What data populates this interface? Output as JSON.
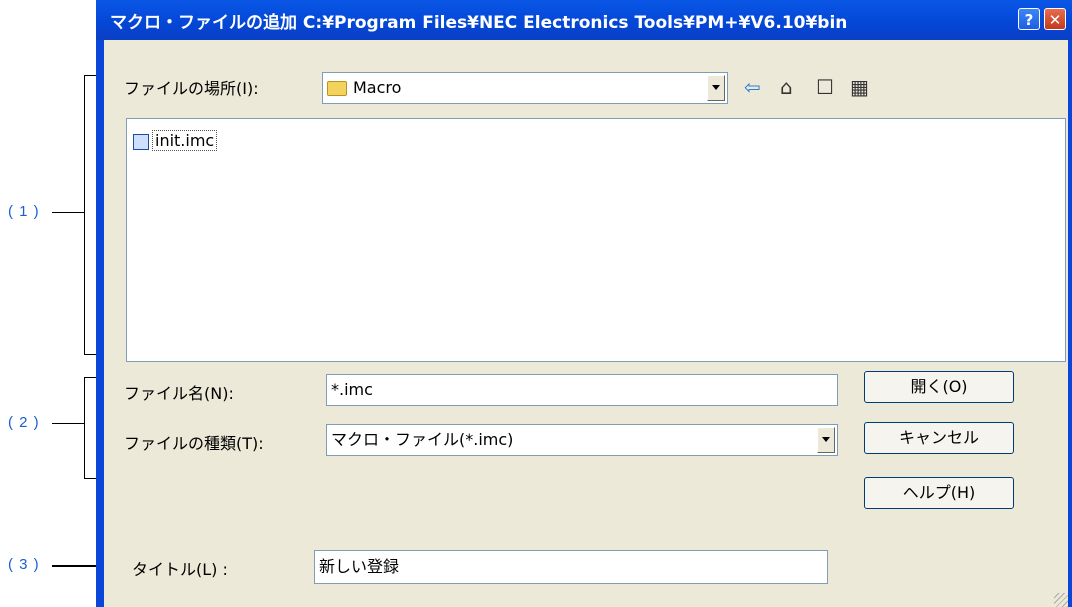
{
  "dialog": {
    "title": "マクロ・ファイルの追加 C:¥Program Files¥NEC Electronics Tools¥PM+¥V6.10¥bin",
    "help_button": "?",
    "close_button": "✕"
  },
  "callouts": [
    "( 1 )",
    "( 2 )",
    "( 3 )"
  ],
  "location": {
    "label": "ファイルの場所(I):",
    "value": "Macro",
    "toolbar": [
      "back-icon",
      "up-folder-icon",
      "new-folder-icon",
      "view-menu-icon"
    ]
  },
  "files": [
    {
      "name": "init.imc",
      "icon": "macro-file-icon"
    }
  ],
  "filename": {
    "label": "ファイル名(N):",
    "value": "*.imc"
  },
  "filetype": {
    "label": "ファイルの種類(T):",
    "value": "マクロ・ファイル(*.imc)"
  },
  "buttons": {
    "open": "開く(O)",
    "cancel": "キャンセル",
    "help": "ヘルプ(H)"
  },
  "title_field": {
    "label": "タイトル(L) :",
    "value": "新しい登録"
  },
  "colors": {
    "callout": "#1a5fd0",
    "titlebar": "#0446d6",
    "client": "#ece9d8"
  }
}
